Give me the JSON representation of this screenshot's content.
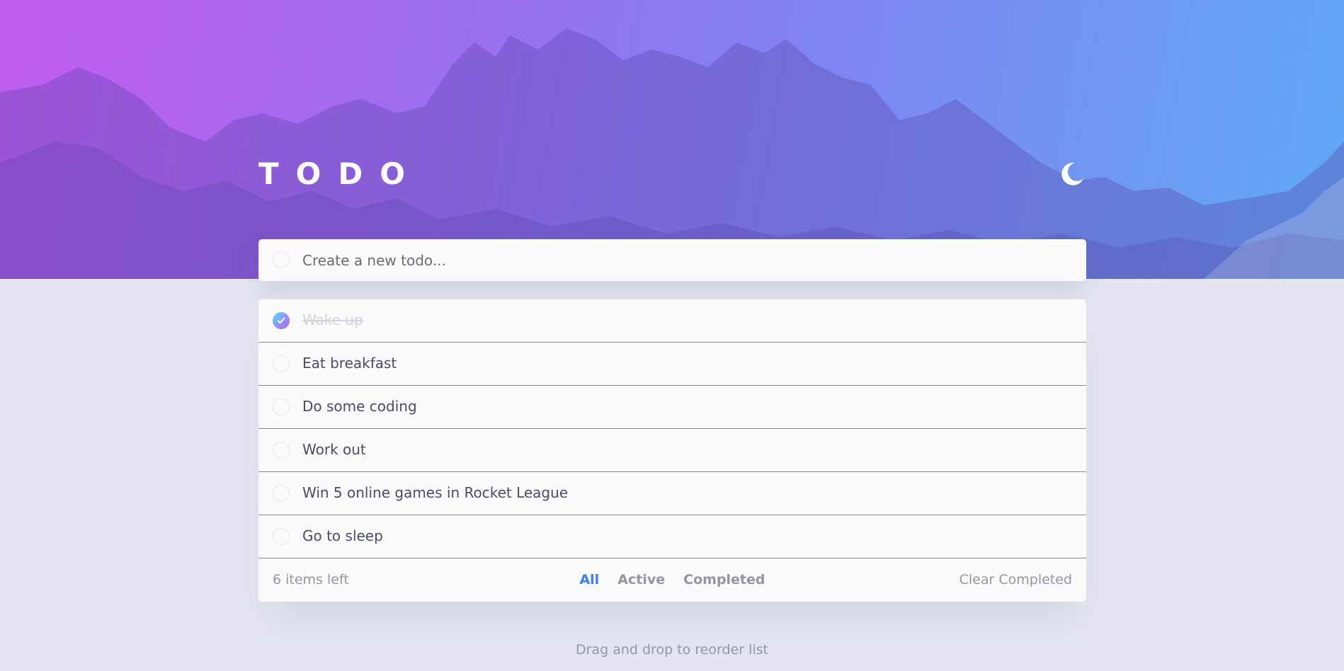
{
  "header": {
    "title": "TODO",
    "theme_icon": "moon-icon"
  },
  "new_todo": {
    "placeholder": "Create a new todo..."
  },
  "todos": [
    {
      "label": "Wake up",
      "completed": true
    },
    {
      "label": "Eat breakfast",
      "completed": false
    },
    {
      "label": "Do some coding",
      "completed": false
    },
    {
      "label": "Work out",
      "completed": false
    },
    {
      "label": "Win 5 online games in Rocket League",
      "completed": false
    },
    {
      "label": "Go to sleep",
      "completed": false
    }
  ],
  "footer": {
    "items_left": "6 items left",
    "filters": [
      "All",
      "Active",
      "Completed"
    ],
    "active_filter": "All",
    "clear_label": "Clear Completed"
  },
  "hint": "Drag and drop to reorder list",
  "colors": {
    "accent": "#3a7cfd",
    "check_gradient_start": "#55ddff",
    "check_gradient_end": "#c058f3",
    "page_background": "#e4e5f1",
    "card_background": "#fafafa"
  }
}
